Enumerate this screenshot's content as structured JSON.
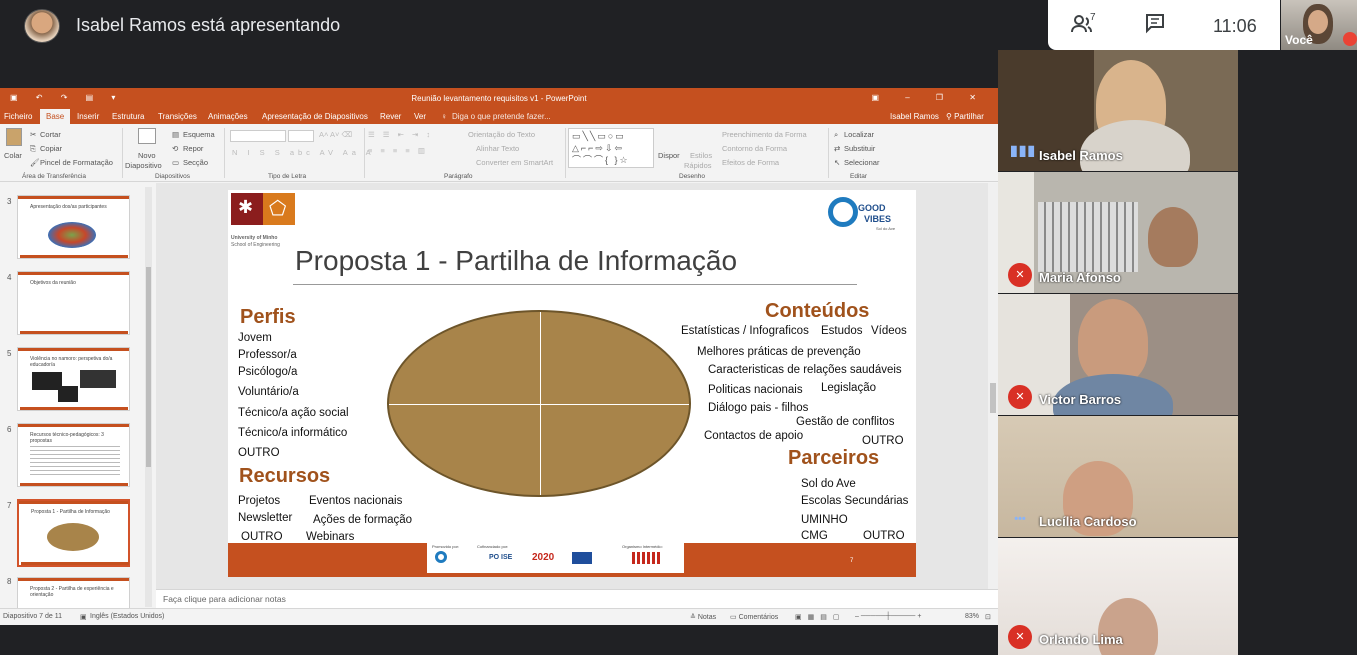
{
  "meet": {
    "presenter_text": "Isabel Ramos está apresentando",
    "participants_count": "7",
    "clock": "11:06",
    "self_label": "Você",
    "tiles": [
      {
        "name": "Isabel Ramos",
        "mic": "speaking",
        "bg": "#7a6a55"
      },
      {
        "name": "Maria Afonso",
        "mic": "muted",
        "bg": "#b9b6ae"
      },
      {
        "name": "Victor Barros",
        "mic": "muted",
        "bg": "#9c8f85"
      },
      {
        "name": "Lucília Cardoso",
        "mic": "dots",
        "bg": "#c7b79f"
      },
      {
        "name": "Orlando Lima",
        "mic": "muted",
        "bg": "#ece7e3"
      }
    ]
  },
  "ppt": {
    "window_title": "Reunião levantamento requisitos v1 - PowerPoint",
    "menu": [
      "Ficheiro",
      "Base",
      "Inserir",
      "Estrutura",
      "Transições",
      "Animações",
      "Apresentação de Diapositivos",
      "Rever",
      "Ver"
    ],
    "search_placeholder": "Diga o que pretende fazer...",
    "user": "Isabel Ramos",
    "share": "Partilhar",
    "ribbon": {
      "colar": "Colar",
      "cortar": "Cortar",
      "copiar": "Copiar",
      "pincel": "Pincel de Formatação",
      "g_clip": "Área de Transferência",
      "novo": "Novo",
      "diapositivo": "Diapositivo",
      "esquema": "Esquema",
      "repor": "Repor",
      "seccao": "Secção",
      "g_slides": "Diapositivos",
      "g_font": "Tipo de Letra",
      "orientacao": "Orientação do Texto",
      "alinhar": "Alinhar Texto",
      "converter": "Converter em SmartArt",
      "g_par": "Parágrafo",
      "dispor": "Dispor",
      "estilos": "Estilos",
      "rapidos": "Rápidos",
      "preench": "Preenchimento da Forma",
      "contorno": "Contorno da Forma",
      "efeitos": "Efeitos de Forma",
      "g_draw": "Desenho",
      "localizar": "Localizar",
      "substituir": "Substituir",
      "selecionar": "Selecionar",
      "g_edit": "Editar"
    },
    "thumbs": [
      {
        "num": "3",
        "title": "Apresentação dos/as participantes"
      },
      {
        "num": "4",
        "title": "Objetivos da reunião"
      },
      {
        "num": "5",
        "title": "Violência no namoro: perspetiva do/a educador/a"
      },
      {
        "num": "6",
        "title": "Recursos técnico-pedagógicos: 3 propostas"
      },
      {
        "num": "7",
        "title": "Proposta 1 - Partilha de Informação"
      },
      {
        "num": "8",
        "title": "Proposta 2 - Partilha de experiência e orientação"
      }
    ],
    "notes_placeholder": "Faça clique para adicionar notas",
    "status": {
      "slide": "Diapositivo 7 de 11",
      "lang": "Inglês (Estados Unidos)",
      "notas": "Notas",
      "comentarios": "Comentários",
      "zoom": "83%"
    }
  },
  "slide": {
    "uni": "University of Minho",
    "school": "School of Engineering",
    "gv1": "GOOD",
    "gv2": "VIBES",
    "gv3": "Sol do Ave",
    "title": "Proposta 1 - Partilha de Informação",
    "perfis_h": "Perfis",
    "perfis": [
      "Jovem",
      "Professor/a",
      "Psicólogo/a",
      "Voluntário/a",
      "Técnico/a ação social",
      "Técnico/a informático",
      "OUTRO"
    ],
    "recursos_h": "Recursos",
    "recursos": [
      "Projetos",
      "Eventos nacionais",
      "Newsletter",
      "Ações de formação",
      "OUTRO",
      "Webinars"
    ],
    "conteudos_h": "Conteúdos",
    "conteudos": [
      "Estatísticas / Infograficos",
      "Estudos",
      "Vídeos",
      "Melhores práticas de prevenção",
      "Caracteristicas de relações saudáveis",
      "Politicas nacionais",
      "Legislação",
      "Diálogo pais - filhos",
      "Gestão de conflitos",
      "Contactos de apoio",
      "OUTRO"
    ],
    "parceiros_h": "Parceiros",
    "parceiros": [
      "Sol do Ave",
      "Escolas Secundárias",
      "UMINHO",
      "CMG",
      "OUTRO"
    ],
    "footer": {
      "promovido": "Promovido por:",
      "cofinanciado": "Cofinanciado por:",
      "organismo": "Organismo Intermédio:",
      "poise": "PO ISE",
      "p2020": "2020",
      "page": "7"
    }
  }
}
